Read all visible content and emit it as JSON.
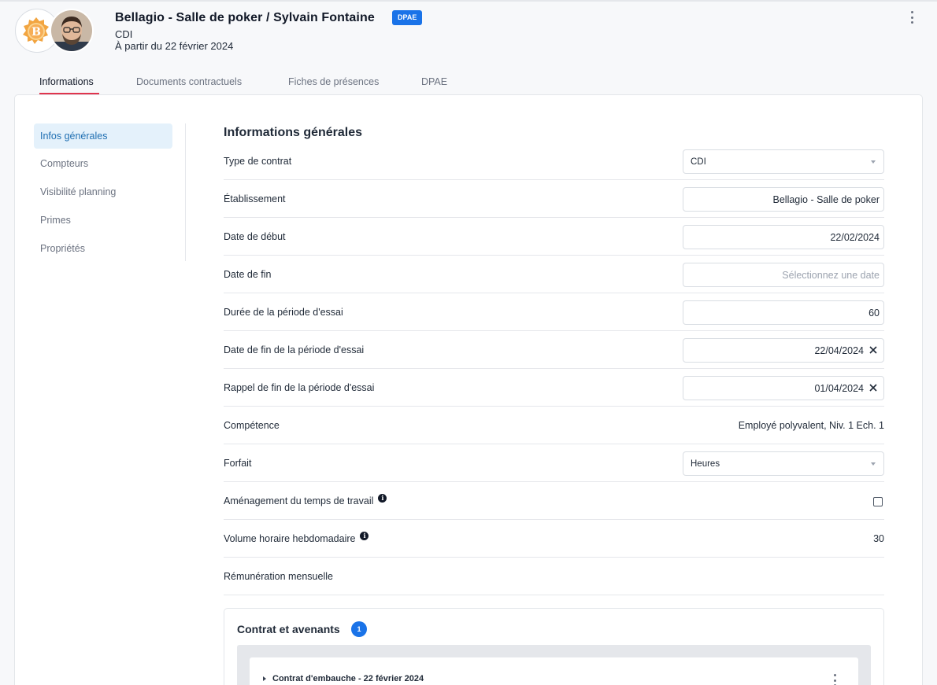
{
  "header": {
    "title": "Bellagio - Salle de poker / Sylvain Fontaine",
    "badge": "DPAE",
    "contract_type": "CDI",
    "start_text": "À partir du 22 février 2024"
  },
  "tabs": [
    {
      "label": "Informations",
      "active": true
    },
    {
      "label": "Documents contractuels",
      "active": false
    },
    {
      "label": "Fiches de présences",
      "active": false
    },
    {
      "label": "DPAE",
      "active": false
    }
  ],
  "sidebar": {
    "items": [
      {
        "label": "Infos générales",
        "active": true
      },
      {
        "label": "Compteurs",
        "active": false
      },
      {
        "label": "Visibilité planning",
        "active": false
      },
      {
        "label": "Primes",
        "active": false
      },
      {
        "label": "Propriétés",
        "active": false
      }
    ]
  },
  "section": {
    "title": "Informations générales",
    "fields": {
      "type_contrat": {
        "label": "Type de contrat",
        "value": "CDI"
      },
      "etablissement": {
        "label": "Établissement",
        "value": "Bellagio - Salle de poker"
      },
      "date_debut": {
        "label": "Date de début",
        "value": "22/02/2024"
      },
      "date_fin": {
        "label": "Date de fin",
        "placeholder": "Sélectionnez une date"
      },
      "duree_essai": {
        "label": "Durée de la période d'essai",
        "value": "60"
      },
      "fin_essai": {
        "label": "Date de fin de la période d'essai",
        "value": "22/04/2024"
      },
      "rappel_essai": {
        "label": "Rappel de fin de la période d'essai",
        "value": "01/04/2024"
      },
      "competence": {
        "label": "Compétence",
        "value": "Employé polyvalent, Niv. 1 Ech. 1"
      },
      "forfait": {
        "label": "Forfait",
        "value": "Heures"
      },
      "amenagement": {
        "label": "Aménagement du temps de travail",
        "checked": false
      },
      "volume_horaire": {
        "label": "Volume horaire hebdomadaire",
        "value": "30"
      },
      "remuneration": {
        "label": "Rémunération mensuelle"
      }
    },
    "info_icon": "i"
  },
  "contracts": {
    "title": "Contrat et avenants",
    "count": "1",
    "items": [
      {
        "label": "Contrat d'embauche - 22 février 2024"
      }
    ]
  }
}
